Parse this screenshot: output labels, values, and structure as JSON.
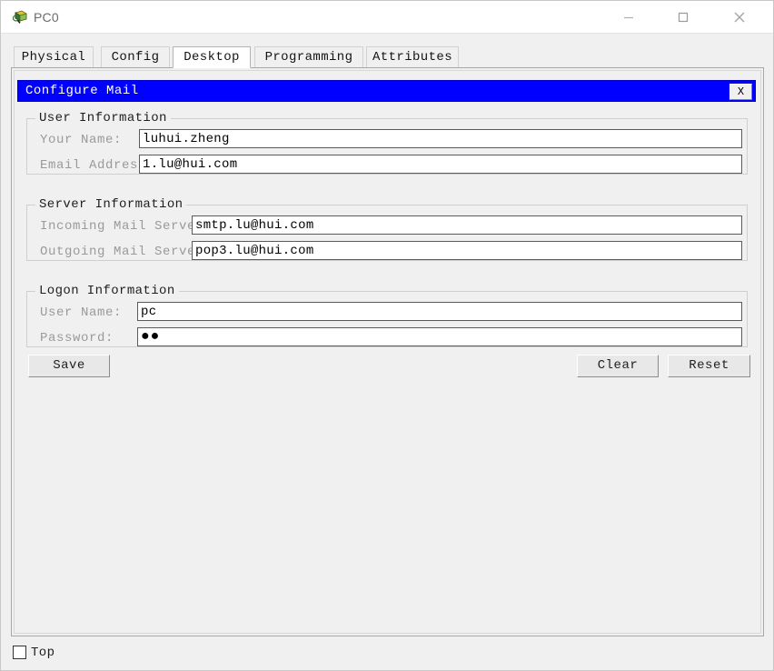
{
  "window": {
    "title": "PC0",
    "icon": "pc-device-icon",
    "controls": {
      "minimize": "minimize-icon",
      "maximize": "maximize-icon",
      "close": "close-icon"
    }
  },
  "tabs": [
    {
      "label": "Physical",
      "selected": false
    },
    {
      "label": "Config",
      "selected": false
    },
    {
      "label": "Desktop",
      "selected": true
    },
    {
      "label": "Programming",
      "selected": false
    },
    {
      "label": "Attributes",
      "selected": false
    }
  ],
  "dialog": {
    "title": "Configure Mail",
    "close_label": "X",
    "title_bg": "#0000ff",
    "title_fg": "#ffffff",
    "groups": [
      {
        "title": "User Information",
        "fields": [
          {
            "label": "Your Name:",
            "value": "luhui.zheng",
            "placeholder": ""
          },
          {
            "label": "Email Address",
            "value": "1.lu@hui.com",
            "placeholder": ""
          }
        ]
      },
      {
        "title": "Server Information",
        "fields": [
          {
            "label": "Incoming Mail Server",
            "value": "smtp.lu@hui.com",
            "placeholder": ""
          },
          {
            "label": "Outgoing Mail Server",
            "value": "pop3.lu@hui.com",
            "placeholder": ""
          }
        ]
      },
      {
        "title": "Logon Information",
        "fields": [
          {
            "label": "User Name:",
            "value": "pc",
            "placeholder": ""
          },
          {
            "label": "Password:",
            "value": "●●",
            "placeholder": ""
          }
        ]
      }
    ],
    "buttons": {
      "save": "Save",
      "clear": "Clear",
      "reset": "Reset"
    }
  },
  "bottom": {
    "top_checkbox_label": "Top",
    "top_checkbox_checked": false
  }
}
